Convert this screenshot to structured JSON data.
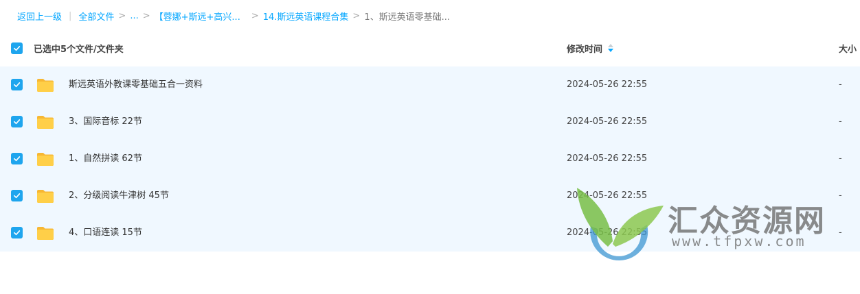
{
  "breadcrumb": {
    "back": "返回上一级",
    "divider": "|",
    "items": [
      "全部文件",
      "...",
      "【蓉娜+斯远+高兴...",
      "14.斯远英语课程合集",
      "1、斯远英语零基础..."
    ],
    "separator": ">"
  },
  "header": {
    "selected_label": "已选中5个文件/文件夹",
    "col_time": "修改时间",
    "col_size": "大小"
  },
  "files": [
    {
      "name": "斯远英语外教课零基础五合一资料",
      "time": "2024-05-26 22:55",
      "size": "-"
    },
    {
      "name": "3、国际音标 22节",
      "time": "2024-05-26 22:55",
      "size": "-"
    },
    {
      "name": "1、自然拼读 62节",
      "time": "2024-05-26 22:55",
      "size": "-"
    },
    {
      "name": "2、分级阅读牛津树 45节",
      "time": "2024-05-26 22:55",
      "size": "-"
    },
    {
      "name": "4、口语连读 15节",
      "time": "2024-05-26 22:55",
      "size": "-"
    }
  ],
  "watermark": {
    "title": "汇众资源网",
    "url": "www.tfpxw.com"
  },
  "colors": {
    "accent": "#06a7ff",
    "checkbox": "#1ea5ee",
    "row_selected_bg": "#f0f8ff",
    "folder": "#ffc93c"
  },
  "icons": {
    "checkbox": "check-icon",
    "folder": "folder-icon",
    "sort": "sort-arrows-icon"
  }
}
